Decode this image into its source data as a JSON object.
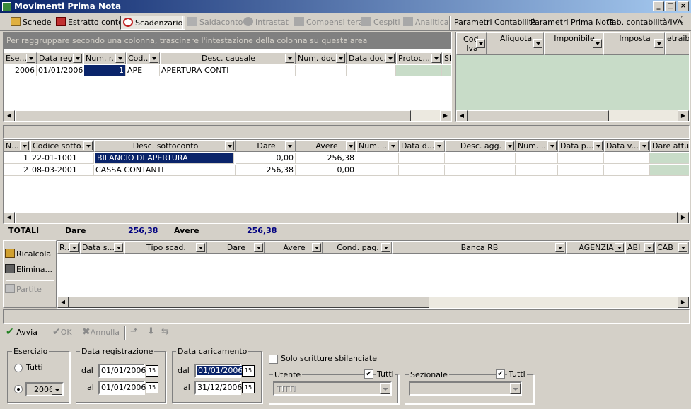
{
  "window": {
    "title": "Movimenti Prima Nota"
  },
  "toolbar": {
    "schede": "Schede",
    "estratto": "Estratto conto",
    "scadenzario": "Scadenzario",
    "saldaconto": "Saldaconto",
    "intrastat": "Intrastat",
    "compensi": "Compensi terzi",
    "cespiti": "Cespiti",
    "analitica": "Analitica",
    "param_contab": "Parametri Contabilità",
    "param_prima": "Parametri Prima Nota",
    "tab_contab": "Tab. contabilità/IVA"
  },
  "top_grid": {
    "group_hint": "Per raggruppare secondo una colonna, trascinare l'intestazione della colonna su questa'area",
    "columns": [
      "Ese...",
      "Data reg.",
      "Num. r...",
      "Cod...",
      "Desc. causale",
      "Num. doc.",
      "Data doc.",
      "Protoc...",
      "Sb"
    ],
    "row": {
      "ese": "2006",
      "data_reg": "01/01/2006",
      "num": "1",
      "cod": "APE",
      "desc": "APERTURA CONTI"
    }
  },
  "iva_grid": {
    "columns": [
      "Cod. Iva",
      "Aliquota",
      "Imponibile",
      "Imposta",
      "etraibi"
    ]
  },
  "detail_grid": {
    "columns": [
      "N...",
      "Codice sotto...",
      "Desc. sottoconto",
      "Dare",
      "Avere",
      "Num. ...",
      "Data d...",
      "Desc. agg.",
      "Num. ...",
      "Data p...",
      "Data v...",
      "Dare attua"
    ],
    "rows": [
      {
        "n": "1",
        "codice": "22-01-1001",
        "desc": "BILANCIO DI APERTURA",
        "dare": "0,00",
        "avere": "256,38"
      },
      {
        "n": "2",
        "codice": "08-03-2001",
        "desc": "CASSA CONTANTI",
        "dare": "256,38",
        "avere": "0,00"
      }
    ]
  },
  "totals": {
    "label": "TOTALI",
    "dare_label": "Dare",
    "dare": "256,38",
    "avere_label": "Avere",
    "avere": "256,38"
  },
  "scad_grid": {
    "columns": [
      "R...",
      "Data s...",
      "Tipo scad.",
      "Dare",
      "Avere",
      "Cond. pag.",
      "Banca RB",
      "AGENZIA",
      "ABI",
      "CAB"
    ]
  },
  "side_buttons": {
    "ricalcola": "Ricalcola",
    "elimina": "Elimina...",
    "partite": "Partite"
  },
  "action_bar": {
    "avvia": "Avvia",
    "ok": "OK",
    "annulla": "Annulla"
  },
  "filters": {
    "esercizio": {
      "label": "Esercizio",
      "tutti": "Tutti",
      "year": "2006"
    },
    "data_reg": {
      "label": "Data registrazione",
      "dal_label": "dal",
      "dal": "01/01/2006",
      "al_label": "al",
      "al": "01/01/2006"
    },
    "data_car": {
      "label": "Data caricamento",
      "dal_label": "dal",
      "dal": "01/01/2006",
      "al_label": "al",
      "al": "31/12/2006"
    },
    "solo_sbil": "Solo scritture sbilanciate",
    "utente": {
      "label": "Utente",
      "tutti": "Tutti",
      "value": "TITTI"
    },
    "sezionale": {
      "label": "Sezionale",
      "tutti": "Tutti",
      "value": ""
    }
  },
  "cal_glyph": "15"
}
